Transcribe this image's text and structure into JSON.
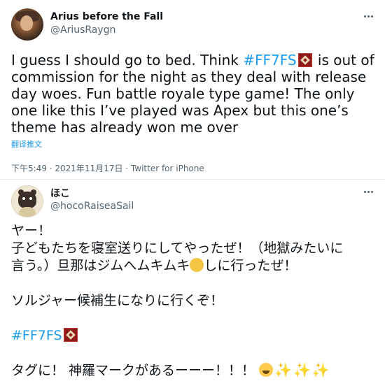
{
  "tweets": [
    {
      "name": "Arius before the Fall",
      "handle": "@AriusRaygn",
      "hashtag": "#FF7FS",
      "text_before": "I guess I should go to bed. Think ",
      "text_after": " is out of commission for the night as they deal with release day woes. Fun battle royale type game! The only one like this I’ve played was Apex but this one’s theme has already won me over",
      "translate_label": "翻译推文",
      "timestamp": "下午5:49 · 2021年11月17日 · Twitter for iPhone"
    },
    {
      "name": "ほこ",
      "handle": "@hocoRaiseaSail",
      "lines": {
        "l1": "ヤー！",
        "l2": "子どもたちを寝室送りにしてやったぜ！（地獄みたいに",
        "l3a": "言う。）旦那はジムへムキムキ",
        "l3b": "しに行ったぜ！",
        "l4": "ソルジャー候補生になりに行くぞ！",
        "hashtag": "#FF7FS",
        "l6": "タグに！ 神羅マークがあるーーー！！！"
      }
    }
  ],
  "icons": {
    "more": "more-horizontal-icon",
    "hashtag_emoji": "ff7-shinra-emblem-icon",
    "muscle": "flexed-biceps-emoji",
    "cry": "loudly-crying-face-emoji",
    "sparkles": "sparkles-emoji"
  },
  "colors": {
    "link": "#1d9bf0",
    "text": "#0f1419",
    "muted": "#536471",
    "divider": "#e6ecf0"
  }
}
